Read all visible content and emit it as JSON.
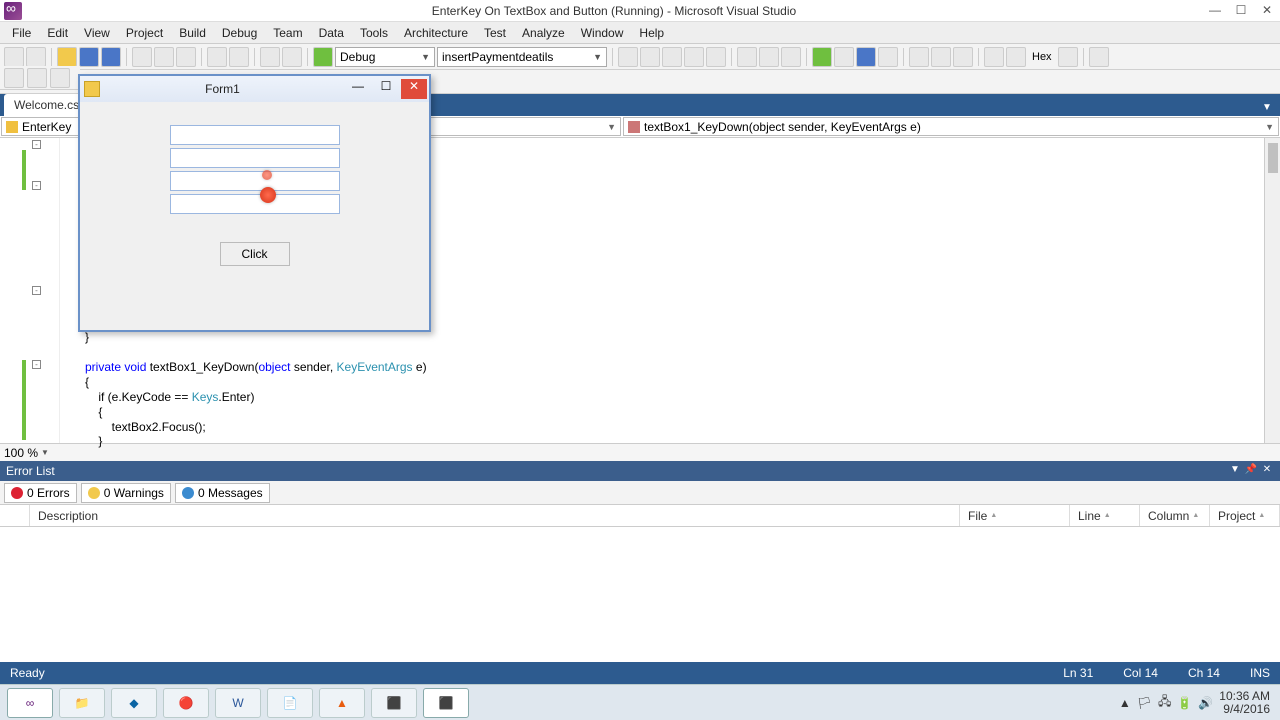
{
  "titlebar": {
    "title": "EnterKey On TextBox and Button (Running) - Microsoft Visual Studio"
  },
  "menu": [
    "File",
    "Edit",
    "View",
    "Project",
    "Build",
    "Debug",
    "Team",
    "Data",
    "Tools",
    "Architecture",
    "Test",
    "Analyze",
    "Window",
    "Help"
  ],
  "toolbar": {
    "config": "Debug",
    "startup": "insertPaymentdeatils",
    "hex": "Hex"
  },
  "doc_tab": "Welcome.cs",
  "nav": {
    "left": "EnterKey",
    "right": "textBox1_KeyDown(object sender, KeyEventArgs e)"
  },
  "code": {
    "brace": "{",
    "l1a": "private",
    "l1b": "void",
    "l1c": " textBox1_KeyDown(",
    "l1d": "object",
    "l1e": " sender, ",
    "l1f": "KeyEventArgs",
    "l1g": " e)",
    "l2": "{",
    "l3a": "    if (e.KeyCode == ",
    "l3b": "Keys",
    "l3c": ".Enter)",
    "l4": "    {",
    "l5": "        textBox2.Focus();",
    "l6": "    }",
    "close_brace": "}"
  },
  "zoom": "100 %",
  "errorlist": {
    "title": "Error List",
    "errors": "0 Errors",
    "warnings": "0 Warnings",
    "messages": "0 Messages",
    "cols": {
      "description": "Description",
      "file": "File",
      "line": "Line",
      "column": "Column",
      "project": "Project"
    }
  },
  "status": {
    "ready": "Ready",
    "ln": "Ln 31",
    "col": "Col 14",
    "ch": "Ch 14",
    "ins": "INS"
  },
  "formwin": {
    "title": "Form1",
    "button": "Click"
  },
  "tray": {
    "time": "10:36 AM",
    "date": "9/4/2016"
  }
}
